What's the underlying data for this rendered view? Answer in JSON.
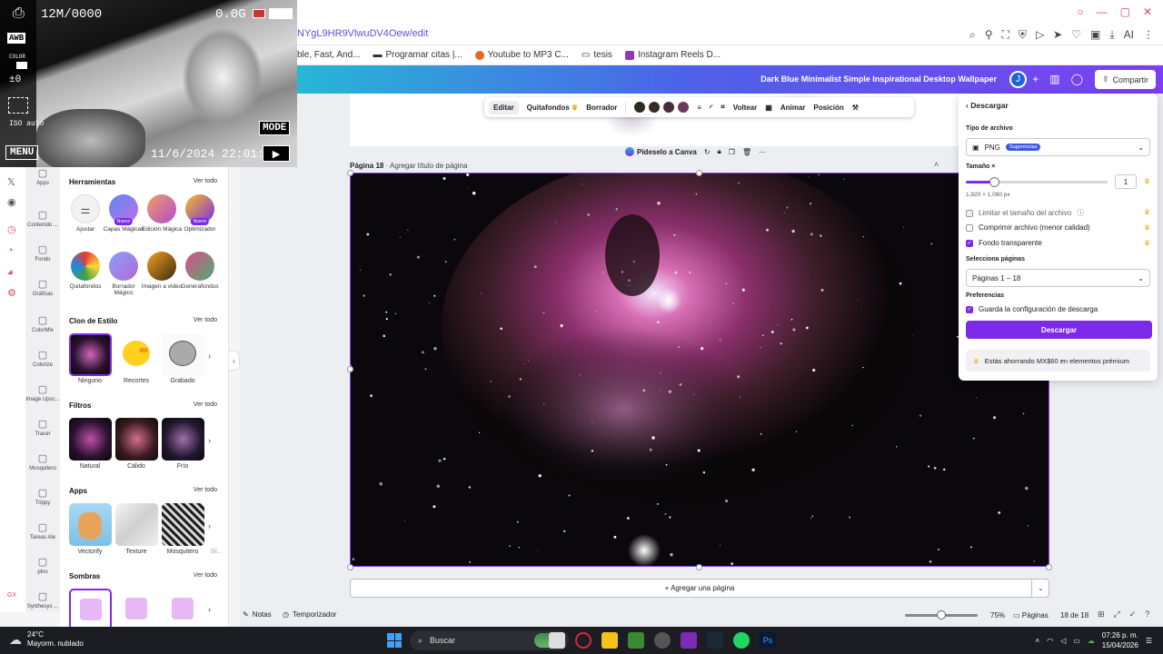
{
  "browser": {
    "url": "NYgL9HR9VlwuDV4Oew/edit",
    "bookmarks": [
      "ble, Fast, And...",
      "Programar citas |...",
      "Youtube to MP3 C...",
      "tesis",
      "Instagram Reels D..."
    ],
    "ai_label": "AI"
  },
  "camera": {
    "resolution": "12M/0000",
    "storage": "0.0G",
    "datetime": "11/6/2024 22:01:36",
    "mode": "MODE",
    "menu": "MENU",
    "awb": "AWB",
    "color": "COLOR",
    "ev": "±0",
    "iso": "ISO auto"
  },
  "header": {
    "doc_title": "Dark Blue Minimalist Simple Inspirational Desktop Wallpaper",
    "avatar": "J",
    "share": "Compartir"
  },
  "nav": [
    {
      "label": "Apps",
      "icon": "apps-icon"
    },
    {
      "label": "Contenido ...",
      "icon": "content-icon"
    },
    {
      "label": "Fondo",
      "icon": "background-icon"
    },
    {
      "label": "Gráficas",
      "icon": "charts-icon"
    },
    {
      "label": "ColorMix",
      "icon": "colormix-icon"
    },
    {
      "label": "Colorize",
      "icon": "colorize-icon"
    },
    {
      "label": "Image Upsc...",
      "icon": "upscale-icon"
    },
    {
      "label": "Tracer",
      "icon": "tracer-icon"
    },
    {
      "label": "Mosquitero",
      "icon": "mosquitero-icon"
    },
    {
      "label": "Trippy",
      "icon": "trippy-icon"
    },
    {
      "label": "Tareas Ale",
      "icon": "tasks-icon"
    },
    {
      "label": "plno",
      "icon": "plno-icon"
    },
    {
      "label": "Synthesys ...",
      "icon": "synthesys-icon"
    }
  ],
  "panel": {
    "tools_title": "Herramientas",
    "see_all": "Ver todo",
    "tools": [
      {
        "label": "Ajustar",
        "badge": ""
      },
      {
        "label": "Capas Mágicas",
        "badge": "Nuevo"
      },
      {
        "label": "Edición Mágica",
        "badge": ""
      },
      {
        "label": "Optimizador",
        "badge": "Nuevo"
      },
      {
        "label": "Quitafondos",
        "badge": ""
      },
      {
        "label": "Borrador Mágico",
        "badge": ""
      },
      {
        "label": "Imagen a video",
        "badge": ""
      },
      {
        "label": "Generafondos",
        "badge": ""
      }
    ],
    "style_title": "Clon de Estilo",
    "styles": [
      "Ninguno",
      "Recortes",
      "Grabado"
    ],
    "filters_title": "Filtros",
    "filters": [
      "Natural",
      "Cálido",
      "Frío"
    ],
    "apps_title": "Apps",
    "apps": [
      "Vectorify",
      "Texture",
      "Mosquitero",
      "Sli..."
    ],
    "shadows_title": "Sombras"
  },
  "toolbar": {
    "items": [
      "Editar",
      "Quitafondos",
      "Borrador",
      "Voltear",
      "Animar",
      "Posición"
    ],
    "swatches": [
      "#2d2a1d",
      "#3a2a20",
      "#4a2d3a",
      "#6a3a5c"
    ]
  },
  "canvas": {
    "ask_canva": "Pídeselo a Canva",
    "page_label": "Página 18",
    "page_title_placeholder": "Agregar título de página",
    "add_page": "+ Agregar una página"
  },
  "bottom": {
    "notes": "Notas",
    "timer": "Temporizador",
    "zoom": "75%",
    "zoom_fraction": 0.5,
    "pages": "Páginas",
    "page_count": "18 de 18"
  },
  "download": {
    "title": "Descargar",
    "file_type_label": "Tipo de archivo",
    "file_type": "PNG",
    "suggestion": "Sugerencias",
    "size_label": "Tamaño ×",
    "size_value": "1",
    "size_fraction": 0.2,
    "dimensions": "1,920 × 1,080 px",
    "opt_limit": "Limitar el tamaño del archivo",
    "opt_compress": "Comprimir archivo (menor calidad)",
    "opt_transparent": "Fondo transparente",
    "pages_label": "Selecciona páginas",
    "pages_value": "Páginas 1 – 18",
    "prefs_label": "Preferencias",
    "save_prefs": "Guarda la configuración de descarga",
    "button": "Descargar",
    "savings": "Estás ahorrando MX$60 en elementos prémium"
  },
  "taskbar": {
    "temp": "24°C",
    "weather": "Mayorm. nublado",
    "search": "Buscar",
    "time": "07:26 p. m.",
    "date": "15/04/2026"
  }
}
